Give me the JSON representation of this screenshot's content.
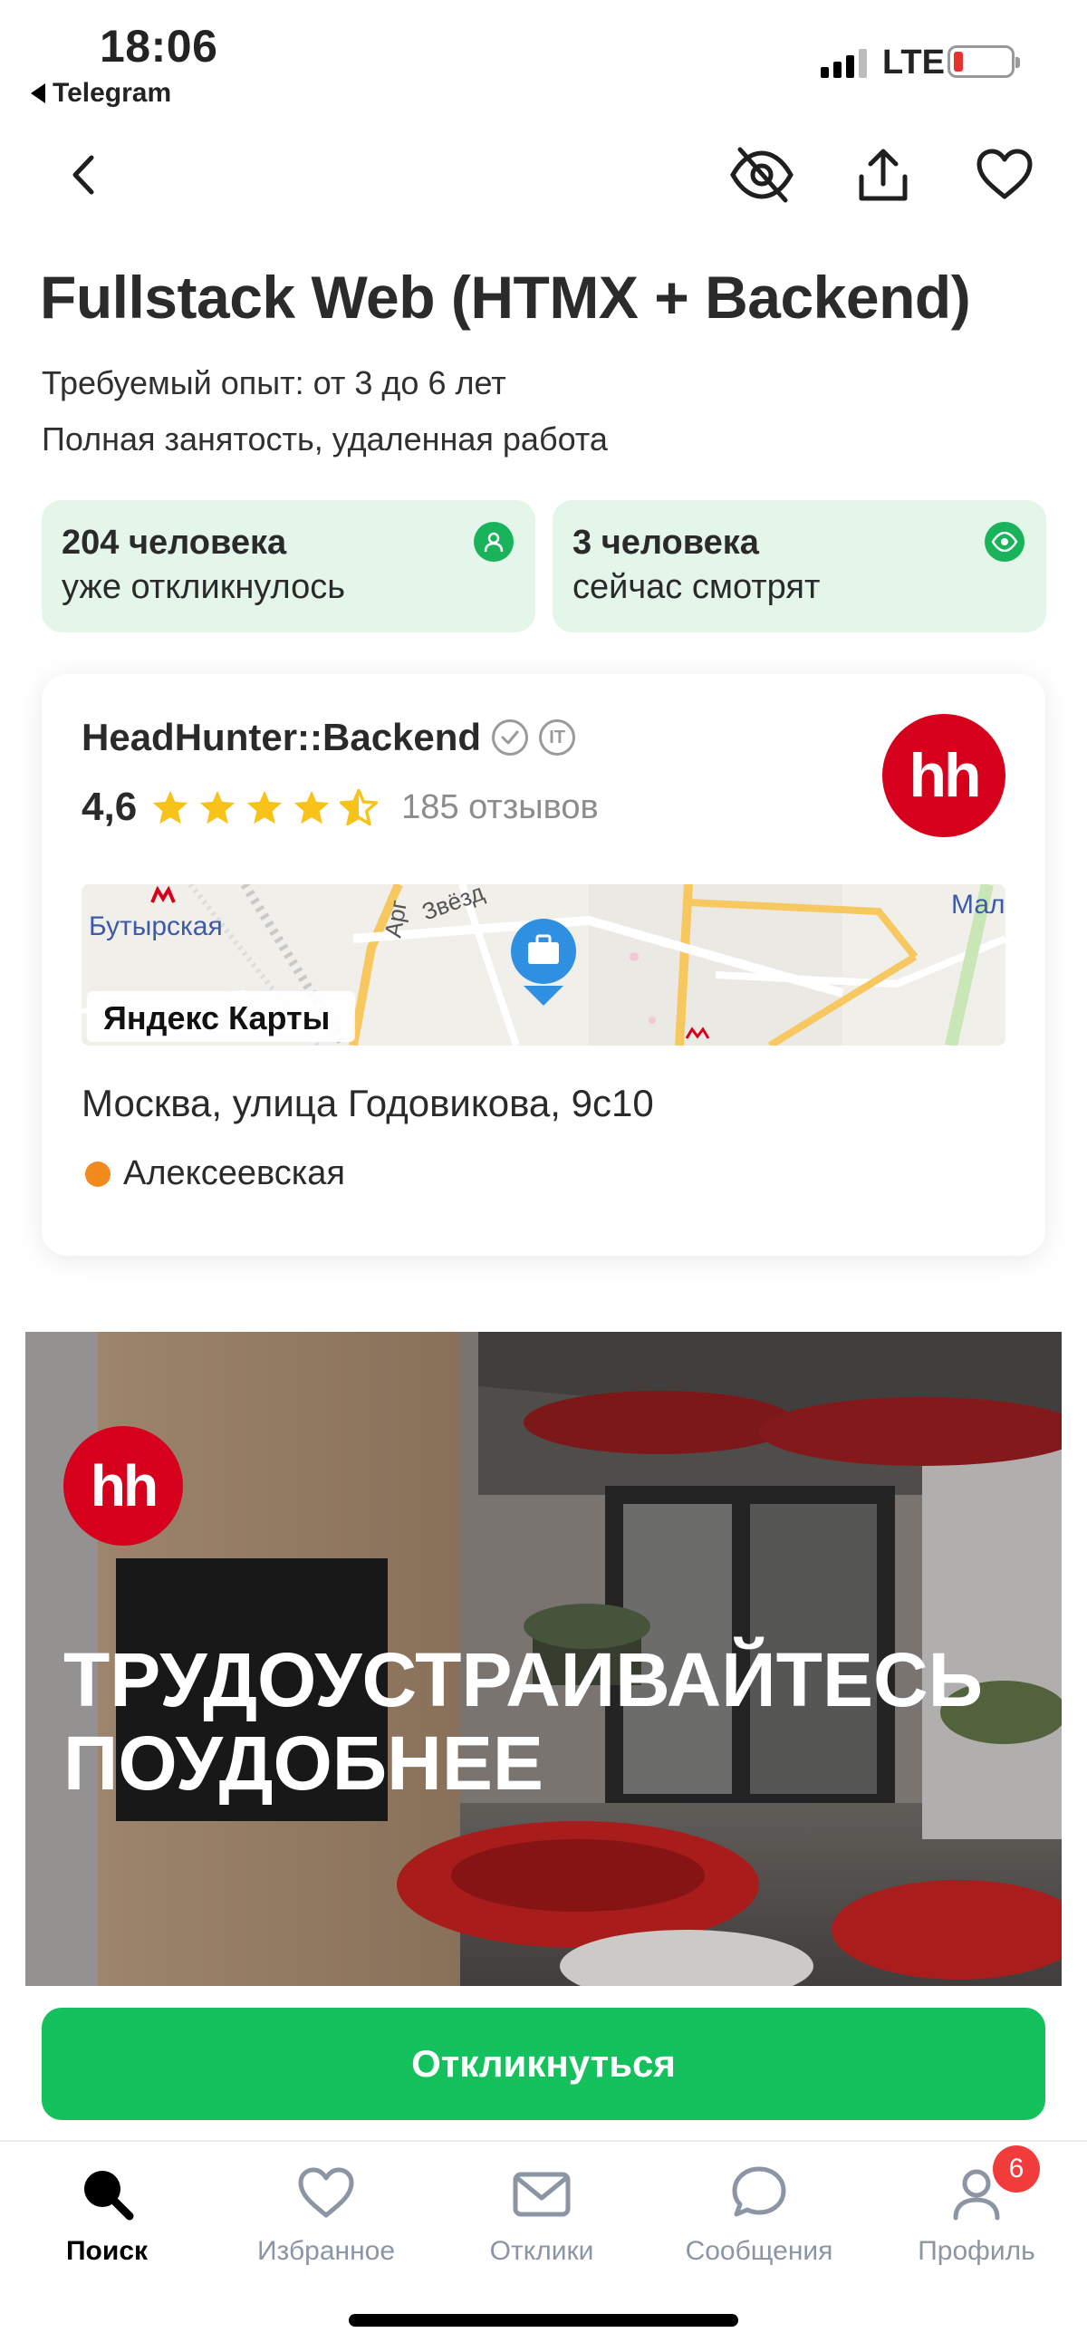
{
  "status_bar": {
    "time": "18:06",
    "back_app": "Telegram",
    "network": "LTE"
  },
  "nav": {
    "back_icon": "chevron-left-icon",
    "hide_icon": "eye-off-icon",
    "share_icon": "share-icon",
    "favorite_icon": "heart-icon"
  },
  "vacancy": {
    "title": "Fullstack Web (HTMX + Backend)",
    "experience": "Требуемый опыт: от 3 до 6 лет",
    "employment": "Полная занятость, удаленная работа"
  },
  "stats": [
    {
      "line1": "204 человека",
      "line2": "уже откликнулось",
      "icon": "person-icon"
    },
    {
      "line1": "3 человека",
      "line2": "сейчас смотрят",
      "icon": "eye-icon"
    }
  ],
  "company": {
    "name": "HeadHunter::Backend",
    "badge_it": "IT",
    "rating": "4,6",
    "rating_value": 4.6,
    "reviews": "185 отзывов",
    "logo_text": "hh",
    "map": {
      "station_left": "Бутырская",
      "street_1": "Арг",
      "street_2": "Звёзд",
      "station_right": "Мал",
      "provider": "Яндекс Карты"
    },
    "address": "Москва, улица Годовикова, 9с10",
    "metro": "Алексеевская"
  },
  "banner": {
    "logo_text": "hh",
    "line1": "ТРУДОУСТРАИВАЙТЕСЬ",
    "line2": "ПОУДОБНЕЕ"
  },
  "respond_button": "Откликнуться",
  "tabbar": {
    "items": [
      {
        "label": "Поиск",
        "icon": "search-icon",
        "active": true
      },
      {
        "label": "Избранное",
        "icon": "heart-icon"
      },
      {
        "label": "Отклики",
        "icon": "mail-icon"
      },
      {
        "label": "Сообщения",
        "icon": "chat-icon"
      },
      {
        "label": "Профиль",
        "icon": "profile-icon"
      }
    ],
    "profile_badge": "6"
  },
  "colors": {
    "accent_green": "#15c15d",
    "stat_bg": "#e4f6ea",
    "brand_red": "#d6001c",
    "star": "#f7c31b"
  }
}
